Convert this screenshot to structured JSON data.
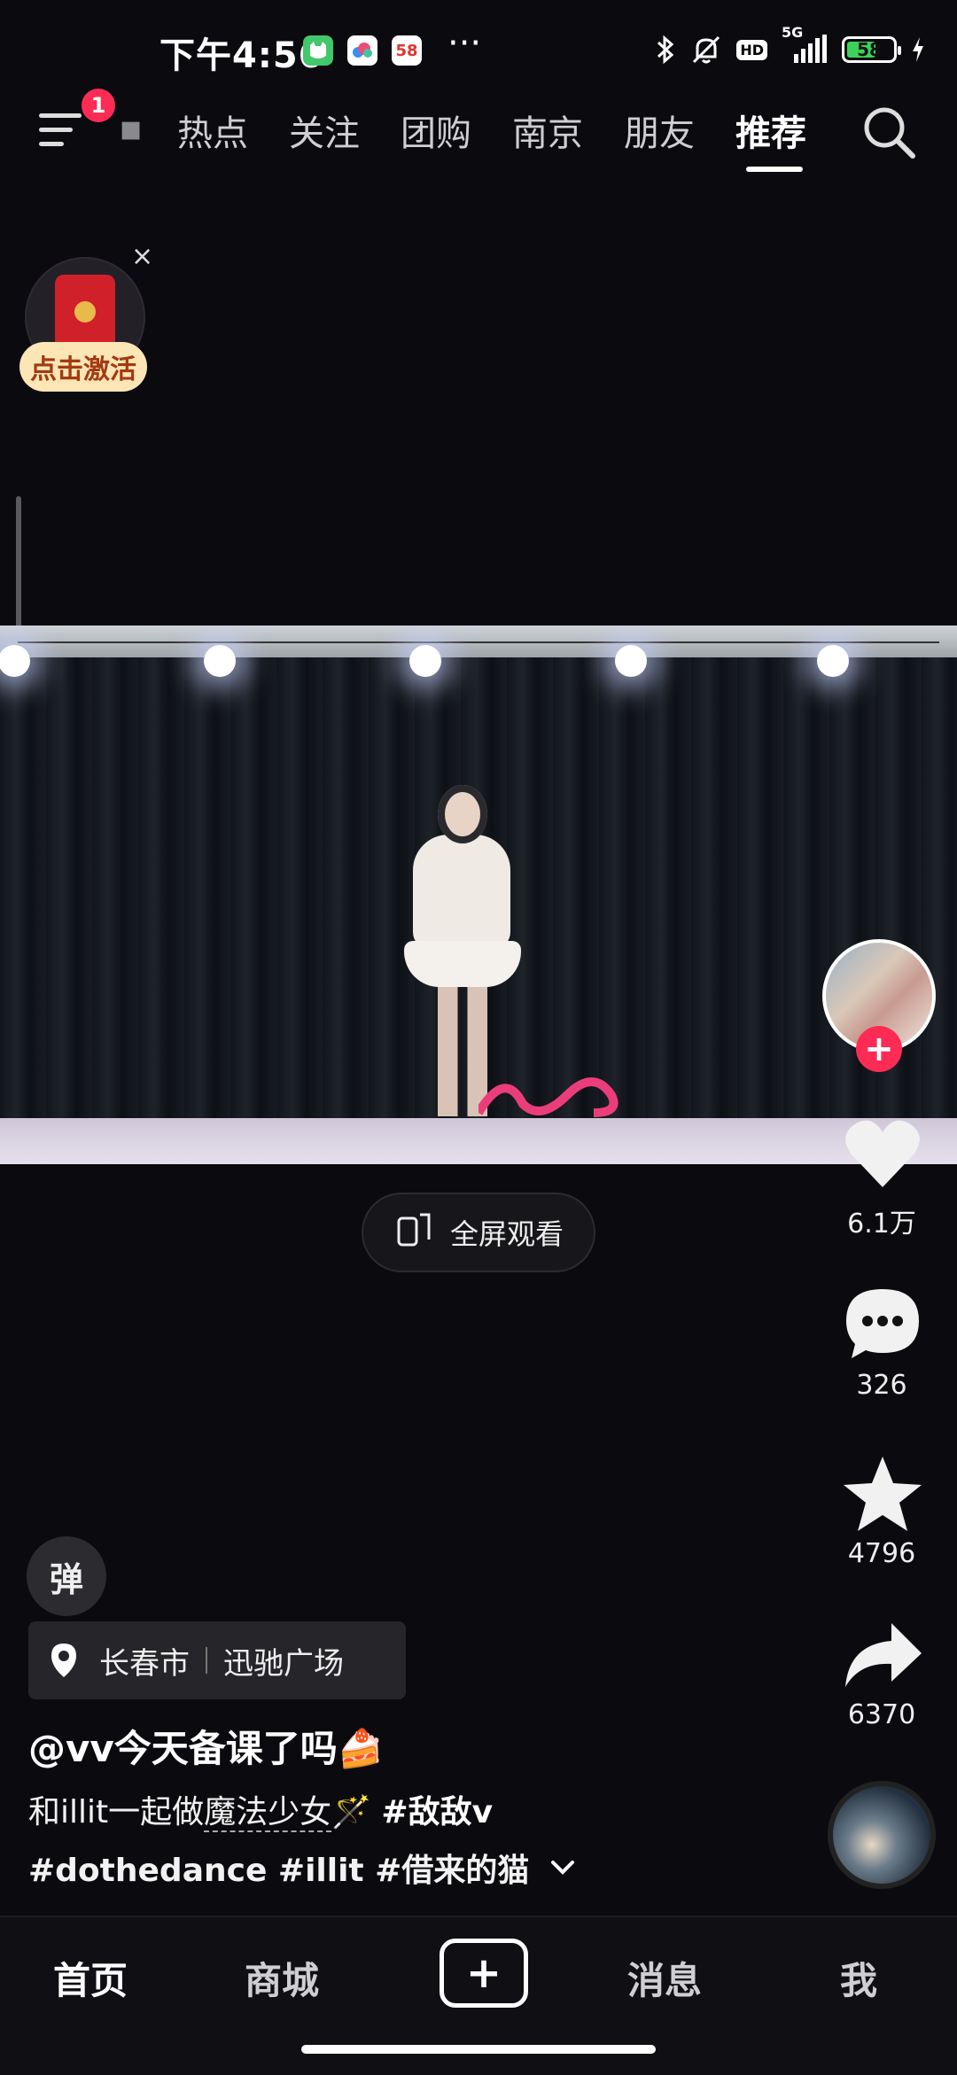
{
  "status_bar": {
    "time": "下午4:56",
    "app_badges": [
      "cat-app-icon",
      "cloud-app-icon",
      "58-app-icon"
    ],
    "badge_58_text": "58",
    "more": "···",
    "network": "5G",
    "hd": "HD",
    "battery": "58",
    "battery_level": 0.58
  },
  "top_nav": {
    "menu_badge": "1",
    "tabs": [
      {
        "label": "热点",
        "active": false
      },
      {
        "label": "关注",
        "active": false
      },
      {
        "label": "团购",
        "active": false
      },
      {
        "label": "南京",
        "active": false
      },
      {
        "label": "朋友",
        "active": false
      },
      {
        "label": "推荐",
        "active": true
      }
    ]
  },
  "red_packet": {
    "label": "点击激活",
    "close": "×"
  },
  "video": {
    "fullscreen_label": "全屏观看"
  },
  "right_rail": {
    "follow": "+",
    "likes": "6.1万",
    "comments": "326",
    "favorites": "4796",
    "shares": "6370"
  },
  "danmu": "弹",
  "location": {
    "city": "长春市",
    "place": "迅驰广场"
  },
  "post": {
    "author": "@vv今天备课了吗🍰",
    "desc_prefix": "和illit一起做",
    "desc_underlined": "魔法少女",
    "desc_emoji": "🪄",
    "desc_tag1": "#敌敌v",
    "desc_line2": "#dothedance #illit #借来的猫"
  },
  "bottom_nav": {
    "home": "首页",
    "mall": "商城",
    "add": "+",
    "messages": "消息",
    "me": "我"
  }
}
